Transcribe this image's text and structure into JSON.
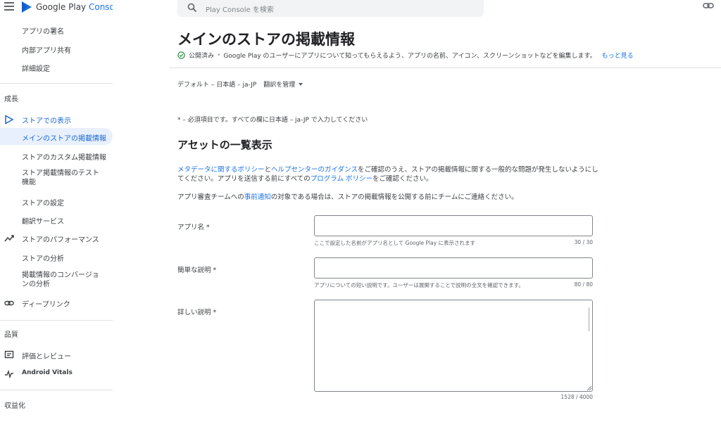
{
  "brand": {
    "name_prefix": "Google Play ",
    "name_suffix": "Console"
  },
  "search": {
    "placeholder": "Play Console を検索"
  },
  "sidebar": {
    "top_items": [
      {
        "label": "アプリの署名"
      },
      {
        "label": "内部アプリ共有"
      },
      {
        "label": "詳細設定"
      }
    ],
    "growth": {
      "header": "成長",
      "store_presence": "ストアでの表示",
      "items": [
        {
          "label": "メインのストアの掲載情報"
        },
        {
          "label": "ストアのカスタム掲載情報"
        },
        {
          "label": "ストア掲載情報のテスト機能"
        },
        {
          "label": "ストアの設定"
        },
        {
          "label": "翻訳サービス"
        }
      ],
      "store_performance": "ストアのパフォーマンス",
      "perf_items": [
        {
          "label": "ストアの分析"
        },
        {
          "label": "掲載情報のコンバージョンの分析"
        }
      ],
      "deep_links": "ディープリンク"
    },
    "quality": {
      "header": "品質",
      "ratings": "評価とレビュー",
      "vitals": "Android Vitals"
    },
    "monetize": {
      "header": "収益化"
    }
  },
  "main": {
    "title": "メインのストアの掲載情報",
    "status": "公開済み",
    "status_desc": "Google Play のユーザーにアプリについて知ってもらえるよう、アプリの名前、アイコン、スクリーンショットなどを編集します。",
    "learn_more": "もっと見る",
    "language": "デフォルト – 日本語 – ja-JP",
    "manage_translations": "翻訳を管理",
    "required_note": "* – 必須項目です。すべての欄に日本語 – ja-JP で入力してください",
    "section_title": "アセットの一覧表示",
    "para1": {
      "link1": "メタデータに関するポリシー",
      "mid1": "と",
      "link2": "ヘルプセンターのガイダンス",
      "rest1": "をご確認のうえ、ストアの掲載情報に関する一般的な問題が発生しないようにしてください。アプリを送信する前にすべての",
      "link3": "プログラム ポリシー",
      "rest2": "をご確認ください。"
    },
    "para2": {
      "pre": "アプリ審査チームへの",
      "link": "事前通知",
      "post": "の対象である場合は、ストアの掲載情報を公開する前にチームにご連絡ください。"
    },
    "fields": {
      "app_name": {
        "label": "アプリ名 *",
        "value": "",
        "helper": "ここで設定した名前がアプリ名として Google Play に表示されます",
        "count": "30 / 30"
      },
      "short_desc": {
        "label": "簡単な説明 *",
        "value": "",
        "helper": "アプリについての短い説明です。ユーザーは展開することで説明の全文を確認できます。",
        "count": "80 / 80"
      },
      "full_desc": {
        "label": "詳しい説明 *",
        "value": "",
        "count": "1528 / 4000"
      }
    }
  },
  "colors": {
    "accent": "#1a73e8",
    "active_bg": "#e8f0fe",
    "status_green": "#1e8e3e"
  }
}
